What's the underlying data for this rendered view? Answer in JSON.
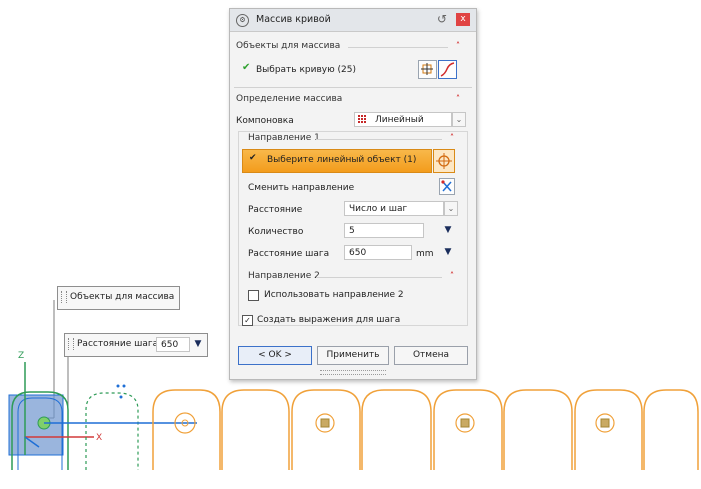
{
  "dialog": {
    "title": "Массив кривой",
    "close_label": "x",
    "reset_label": "↺",
    "section_objects": "Объекты для массива",
    "select_curve": "Выбрать кривую (25)",
    "section_definition": "Определение массива",
    "layout_label": "Компоновка",
    "layout_value": "Линейный",
    "direction1_title": "Направление 1",
    "select_linear": "Выберите линейный объект (1)",
    "reverse_direction": "Сменить направление",
    "distance_label": "Расстояние",
    "distance_value": "Число и шаг",
    "count_label": "Количество",
    "count_value": "5",
    "pitch_label": "Расстояние шага",
    "pitch_value": "650",
    "pitch_unit": "mm",
    "direction2_title": "Направление 2",
    "use_direction2": "Использовать направление 2",
    "use_direction2_checked": false,
    "create_expressions": "Создать выражения для шага",
    "create_expressions_checked": true,
    "ok_label": "< OK >",
    "apply_label": "Применить",
    "cancel_label": "Отмена"
  },
  "canvas": {
    "tooltip_objects": "Объекты для массива",
    "tooltip_pitch_label": "Расстояние шага",
    "tooltip_pitch_value": "650",
    "axis_z": "Z",
    "axis_x": "X",
    "accent_color": "#f0a13a",
    "sketch_color": "#2e9b57",
    "selection_color": "#1f6fd6"
  },
  "icons": [
    "dialog-icon",
    "close-icon",
    "reset-icon",
    "check-icon",
    "curve-select-icon",
    "curve-icon",
    "layout-grid-icon",
    "target-icon",
    "reverse-direction-icon",
    "spinner-icon",
    "chevron-up-icon",
    "dropdown-arrow-icon"
  ]
}
